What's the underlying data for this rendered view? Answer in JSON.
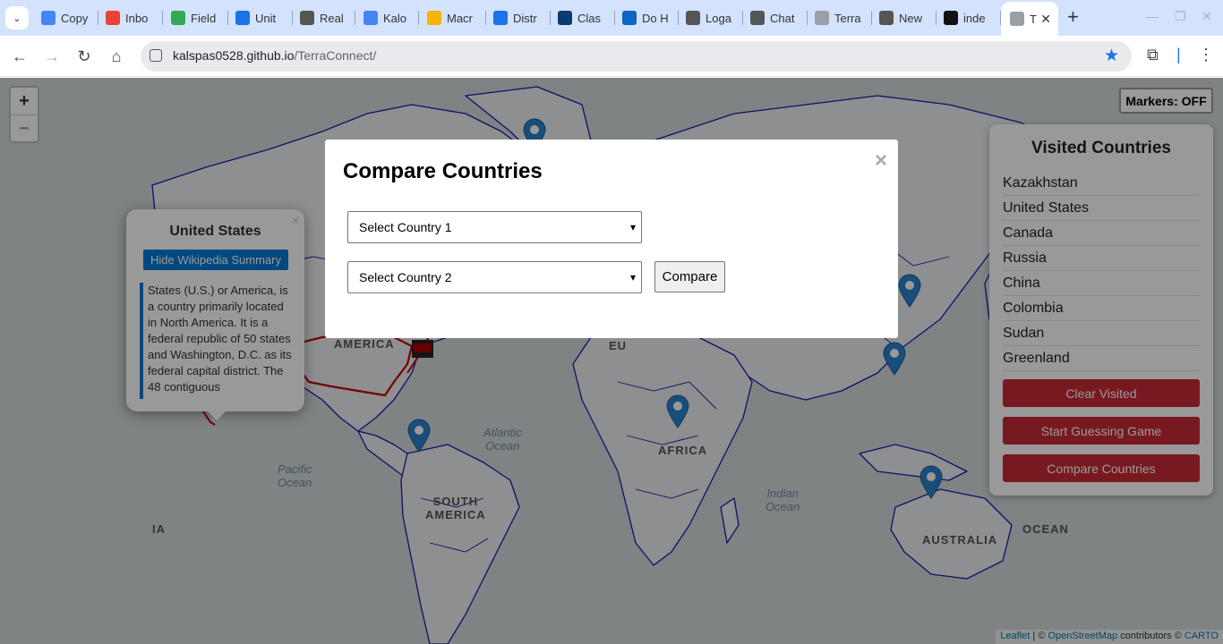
{
  "browser": {
    "tabs": [
      {
        "title": "Copy",
        "favicon": "docs-icon",
        "color": "#4285f4"
      },
      {
        "title": "Inbo",
        "favicon": "gmail-icon",
        "color": "#ea4335"
      },
      {
        "title": "Field",
        "favicon": "field-icon",
        "color": "#34a853"
      },
      {
        "title": "Unit",
        "favicon": "classroom-icon",
        "color": "#1a73e8"
      },
      {
        "title": "Real",
        "favicon": "chatgpt-icon",
        "color": "#555555"
      },
      {
        "title": "Kalo",
        "favicon": "docs-icon",
        "color": "#4285f4"
      },
      {
        "title": "Macr",
        "favicon": "slides-icon",
        "color": "#f4b400"
      },
      {
        "title": "Distr",
        "favicon": "cloud-icon",
        "color": "#1a73e8"
      },
      {
        "title": "Clas",
        "favicon": "sis-icon",
        "color": "#0b3a6f"
      },
      {
        "title": "Do H",
        "favicon": "p-icon",
        "color": "#0a66c2"
      },
      {
        "title": "Loga",
        "favicon": "chatgpt-icon",
        "color": "#555555"
      },
      {
        "title": "Chat",
        "favicon": "chatgpt-icon",
        "color": "#555555"
      },
      {
        "title": "Terra",
        "favicon": "globe-icon",
        "color": "#9aa0a6"
      },
      {
        "title": "New",
        "favicon": "chatgpt-icon",
        "color": "#555555"
      },
      {
        "title": "inde",
        "favicon": "github-icon",
        "color": "#111111"
      },
      {
        "title": "T",
        "favicon": "globe-icon",
        "color": "#9aa0a6"
      }
    ],
    "url_host": "kalspas0528.github.io",
    "url_path": "/TerraConnect/"
  },
  "map": {
    "zoom_in": "+",
    "zoom_out": "−",
    "markers_toggle": "Markers: OFF",
    "labels": {
      "america": "AMERICA",
      "eu": "EU",
      "atlantic": "Atlantic\nOcean",
      "pacific": "Pacific\nOcean",
      "south_america": "SOUTH\nAMERICA",
      "africa": "AFRICA",
      "indian": "Indian\nOcean",
      "australia": "AUSTRALIA",
      "ocean": "OCEAN",
      "ia": "IA"
    },
    "attribution": {
      "leaflet": "Leaflet",
      "sep": " | © ",
      "osm": "OpenStreetMap",
      "contrib": " contributors © ",
      "carto": "CARTO"
    }
  },
  "popup": {
    "title": "United States",
    "button": "Hide Wikipedia Summary",
    "close": "×",
    "summary": "States (U.S.) or America, is a country primarily located in North America. It is a federal republic of 50 states and Washington, D.C. as its federal capital district. The 48 contiguous"
  },
  "panel": {
    "title": "Visited Countries",
    "countries": [
      "Kazakhstan",
      "United States",
      "Canada",
      "Russia",
      "China",
      "Colombia",
      "Sudan",
      "Greenland"
    ],
    "buttons": {
      "clear": "Clear Visited",
      "game": "Start Guessing Game",
      "compare": "Compare Countries"
    },
    "accent": "#c92a36"
  },
  "modal": {
    "title": "Compare Countries",
    "close": "×",
    "select1": "Select Country 1",
    "select2": "Select Country 2",
    "compare_button": "Compare"
  }
}
